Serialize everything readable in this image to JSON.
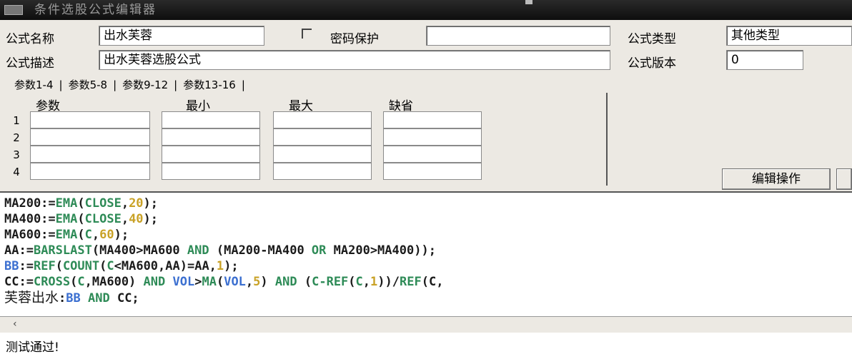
{
  "window": {
    "title": "条件选股公式编辑器"
  },
  "form": {
    "name_label": "公式名称",
    "name_value": "出水芙蓉",
    "password_label": "密码保护",
    "password_value": "",
    "type_label": "公式类型",
    "type_value": "其他类型",
    "desc_label": "公式描述",
    "desc_value": "出水芙蓉选股公式",
    "version_label": "公式版本",
    "version_value": "0"
  },
  "tabs": [
    "参数1-4",
    "参数5-8",
    "参数9-12",
    "参数13-16"
  ],
  "param_table": {
    "headers": [
      "参数",
      "最小",
      "最大",
      "缺省"
    ],
    "rows": [
      "1",
      "2",
      "3",
      "4"
    ]
  },
  "buttons": {
    "edit_ops": "编辑操作"
  },
  "code_lines": [
    "MA200:=EMA(CLOSE,20);",
    "MA400:=EMA(CLOSE,40);",
    "MA600:=EMA(C,60);",
    "AA:=BARSLAST(MA400>MA600 AND (MA200-MA400 OR MA200>MA400));",
    "BB:=REF(COUNT(C<MA600,AA)=AA,1);",
    "CC:=CROSS(C,MA600) AND VOL>MA(VOL,5) AND (C-REF(C,1))/REF(C,",
    "芙蓉出水:BB AND CC;"
  ],
  "status_text": "测试通过!",
  "colors": {
    "keyword": "#1b1b1b",
    "function": "#2e8b57",
    "number": "#c9a227",
    "variable": "#3b6fd0"
  }
}
